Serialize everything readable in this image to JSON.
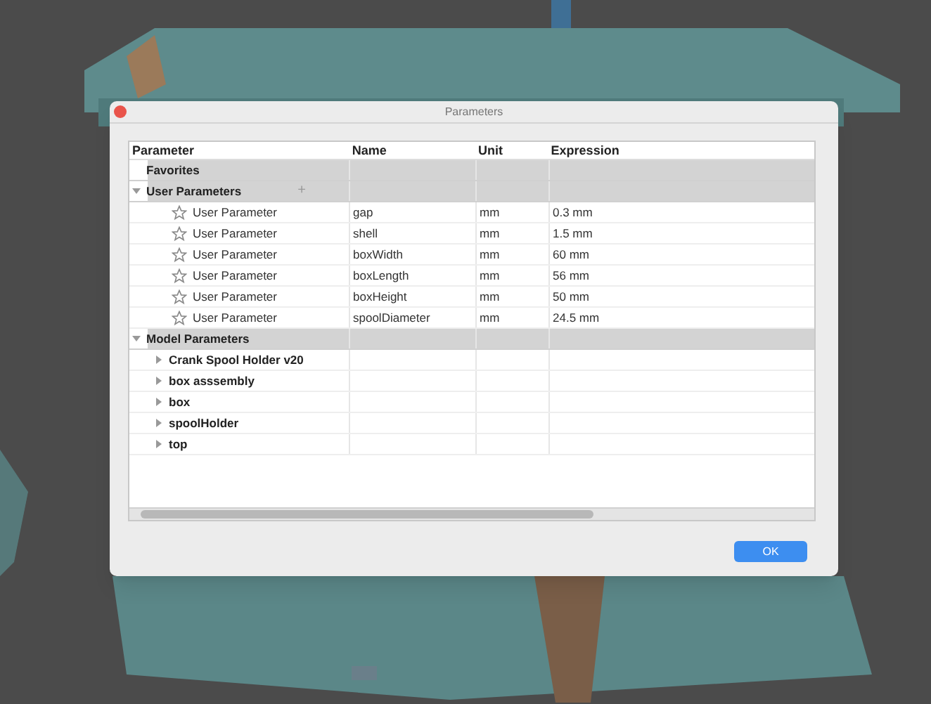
{
  "window": {
    "title": "Parameters"
  },
  "table": {
    "columns": [
      "Parameter",
      "Name",
      "Unit",
      "Expression"
    ],
    "groups": [
      {
        "label": "Favorites"
      },
      {
        "label": "User Parameters",
        "expanded": true,
        "add_button": "+",
        "rows": [
          {
            "parameter": "User Parameter",
            "name": "gap",
            "unit": "mm",
            "expression": "0.3 mm",
            "favorite": false
          },
          {
            "parameter": "User Parameter",
            "name": "shell",
            "unit": "mm",
            "expression": "1.5 mm",
            "favorite": false
          },
          {
            "parameter": "User Parameter",
            "name": "boxWidth",
            "unit": "mm",
            "expression": "60 mm",
            "favorite": false
          },
          {
            "parameter": "User Parameter",
            "name": "boxLength",
            "unit": "mm",
            "expression": "56 mm",
            "favorite": false
          },
          {
            "parameter": "User Parameter",
            "name": "boxHeight",
            "unit": "mm",
            "expression": "50 mm",
            "favorite": false
          },
          {
            "parameter": "User Parameter",
            "name": "spoolDiameter",
            "unit": "mm",
            "expression": "24.5 mm",
            "favorite": false
          }
        ]
      },
      {
        "label": "Model Parameters",
        "expanded": true,
        "children": [
          {
            "label": "Crank Spool Holder v20",
            "expanded": false
          },
          {
            "label": "box asssembly",
            "expanded": false
          },
          {
            "label": "box",
            "expanded": false
          },
          {
            "label": "spoolHolder",
            "expanded": false
          },
          {
            "label": "top",
            "expanded": false
          }
        ]
      }
    ]
  },
  "buttons": [
    {
      "label": "OK",
      "kind": "primary"
    }
  ]
}
